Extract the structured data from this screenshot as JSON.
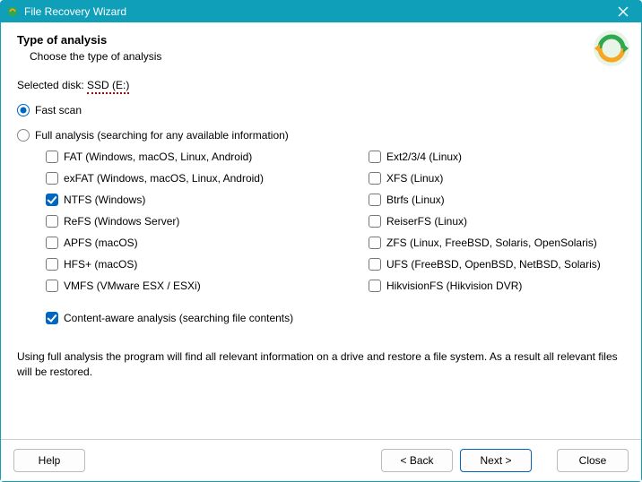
{
  "titlebar": {
    "title": "File Recovery Wizard"
  },
  "header": {
    "heading": "Type of analysis",
    "subtitle": "Choose the type of analysis"
  },
  "selected_disk": {
    "label": "Selected disk: ",
    "value": "SSD (E:)"
  },
  "scan_options": {
    "fast": {
      "label": "Fast scan",
      "checked": true
    },
    "full": {
      "label": "Full analysis (searching for any available information)",
      "checked": false
    }
  },
  "filesystems_left": [
    {
      "key": "fat",
      "label": "FAT (Windows, macOS, Linux, Android)",
      "checked": false
    },
    {
      "key": "exfat",
      "label": "exFAT (Windows, macOS, Linux, Android)",
      "checked": false
    },
    {
      "key": "ntfs",
      "label": "NTFS (Windows)",
      "checked": true
    },
    {
      "key": "refs",
      "label": "ReFS (Windows Server)",
      "checked": false
    },
    {
      "key": "apfs",
      "label": "APFS (macOS)",
      "checked": false
    },
    {
      "key": "hfs",
      "label": "HFS+ (macOS)",
      "checked": false
    },
    {
      "key": "vmfs",
      "label": "VMFS (VMware ESX / ESXi)",
      "checked": false
    }
  ],
  "filesystems_right": [
    {
      "key": "ext",
      "label": "Ext2/3/4 (Linux)",
      "checked": false
    },
    {
      "key": "xfs",
      "label": "XFS (Linux)",
      "checked": false
    },
    {
      "key": "btrfs",
      "label": "Btrfs (Linux)",
      "checked": false
    },
    {
      "key": "reiserfs",
      "label": "ReiserFS (Linux)",
      "checked": false
    },
    {
      "key": "zfs",
      "label": "ZFS (Linux, FreeBSD, Solaris, OpenSolaris)",
      "checked": false
    },
    {
      "key": "ufs",
      "label": "UFS (FreeBSD, OpenBSD, NetBSD, Solaris)",
      "checked": false
    },
    {
      "key": "hikvision",
      "label": "HikvisionFS (Hikvision DVR)",
      "checked": false
    }
  ],
  "content_aware": {
    "label": "Content-aware analysis (searching file contents)",
    "checked": true
  },
  "info_text": "Using full analysis the program will find all relevant information on a drive and restore a file system. As a result all relevant files will be restored.",
  "buttons": {
    "help": "Help",
    "back": "< Back",
    "next": "Next >",
    "close": "Close"
  }
}
